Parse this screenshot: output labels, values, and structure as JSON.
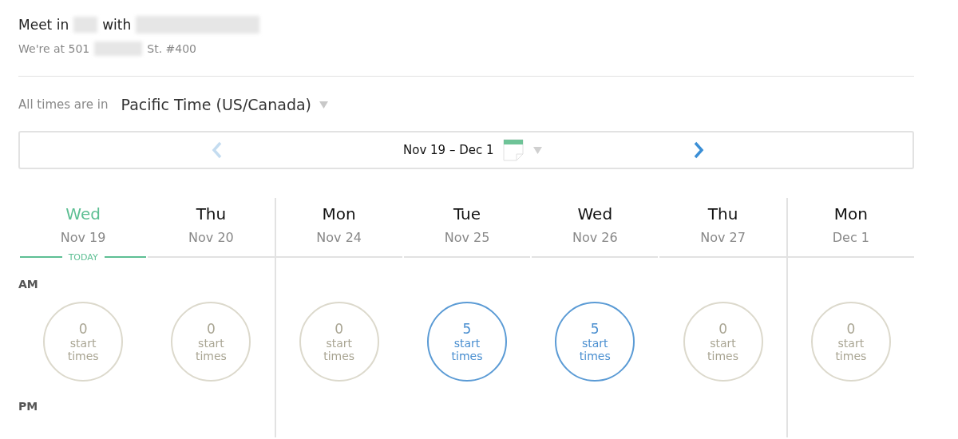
{
  "header": {
    "title_parts": [
      "Meet in",
      "with"
    ],
    "address_parts": [
      "We're at 501",
      "St. #400"
    ]
  },
  "timezone": {
    "label": "All times are in",
    "value": "Pacific Time (US/Canada)"
  },
  "range_nav": {
    "prev_disabled": true,
    "range": "Nov 19 – Dec 1"
  },
  "today_label": "TODAY",
  "days": [
    {
      "day": "Wed",
      "date": "Nov 19",
      "today": true,
      "week_start": false,
      "count": "0",
      "unit": "start times",
      "available": false
    },
    {
      "day": "Thu",
      "date": "Nov 20",
      "today": false,
      "week_start": false,
      "count": "0",
      "unit": "start times",
      "available": false
    },
    {
      "day": "Mon",
      "date": "Nov 24",
      "today": false,
      "week_start": true,
      "count": "0",
      "unit": "start times",
      "available": false
    },
    {
      "day": "Tue",
      "date": "Nov 25",
      "today": false,
      "week_start": false,
      "count": "5",
      "unit": "start times",
      "available": true
    },
    {
      "day": "Wed",
      "date": "Nov 26",
      "today": false,
      "week_start": false,
      "count": "5",
      "unit": "start times",
      "available": true
    },
    {
      "day": "Thu",
      "date": "Nov 27",
      "today": false,
      "week_start": false,
      "count": "0",
      "unit": "start times",
      "available": false
    },
    {
      "day": "Mon",
      "date": "Dec 1",
      "today": false,
      "week_start": true,
      "count": "0",
      "unit": "start times",
      "available": false
    }
  ],
  "periods": [
    "AM",
    "PM"
  ]
}
